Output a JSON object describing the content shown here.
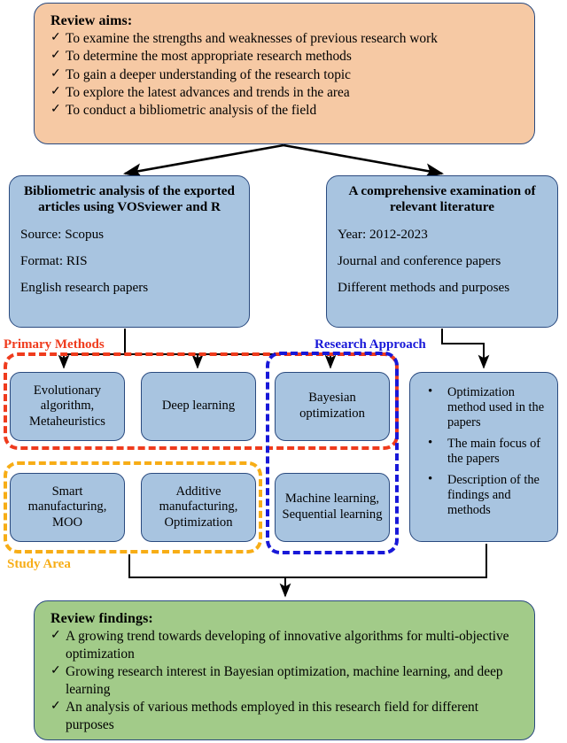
{
  "aims": {
    "title": "Review aims:",
    "items": [
      "To examine the strengths and weaknesses of previous research work",
      "To determine the most appropriate research methods",
      "To gain a deeper understanding of the research topic",
      "To explore the latest advances and trends in the area",
      "To conduct a bibliometric analysis of the field"
    ],
    "tick": "✓",
    "fill_color": "#f6c9a4"
  },
  "bibliometric": {
    "title": "Bibliometric analysis of the exported articles using VOSviewer and R",
    "lines": [
      "Source: Scopus",
      "Format: RIS",
      "English research papers"
    ],
    "fill_color": "#a8c4e0"
  },
  "comprehensive": {
    "title": "A comprehensive examination of relevant literature",
    "lines": [
      "Year: 2012-2023",
      "Journal and conference papers",
      "Different methods and purposes"
    ],
    "fill_color": "#a8c4e0"
  },
  "groups": {
    "primary_methods": {
      "label": "Primary Methods",
      "color": "#ef3b1d"
    },
    "research_approach": {
      "label": "Research Approach",
      "color": "#1818d8"
    },
    "study_area": {
      "label": "Study Area",
      "color": "#f7ad16"
    }
  },
  "cards": {
    "evolutionary": "Evolutionary algorithm, Metaheuristics",
    "deep_learning": "Deep learning",
    "bayesian": "Bayesian optimization",
    "smart_manufacturing": "Smart manufacturing, MOO",
    "additive_manufacturing": "Additive manufacturing, Optimization",
    "machine_learning": "Machine learning, Sequential learning"
  },
  "analysis_points": {
    "bullet": "•",
    "items": [
      "Optimization method used in the papers",
      "The main focus of the papers",
      "Description of the findings and methods"
    ]
  },
  "findings": {
    "title": "Review findings:",
    "tick": "✓",
    "items": [
      "A growing trend towards developing of innovative algorithms for multi-objective optimization",
      "Growing research interest in Bayesian optimization, machine learning, and deep learning",
      "An analysis of various methods employed in this research field for different purposes"
    ],
    "fill_color": "#a2cb89"
  }
}
